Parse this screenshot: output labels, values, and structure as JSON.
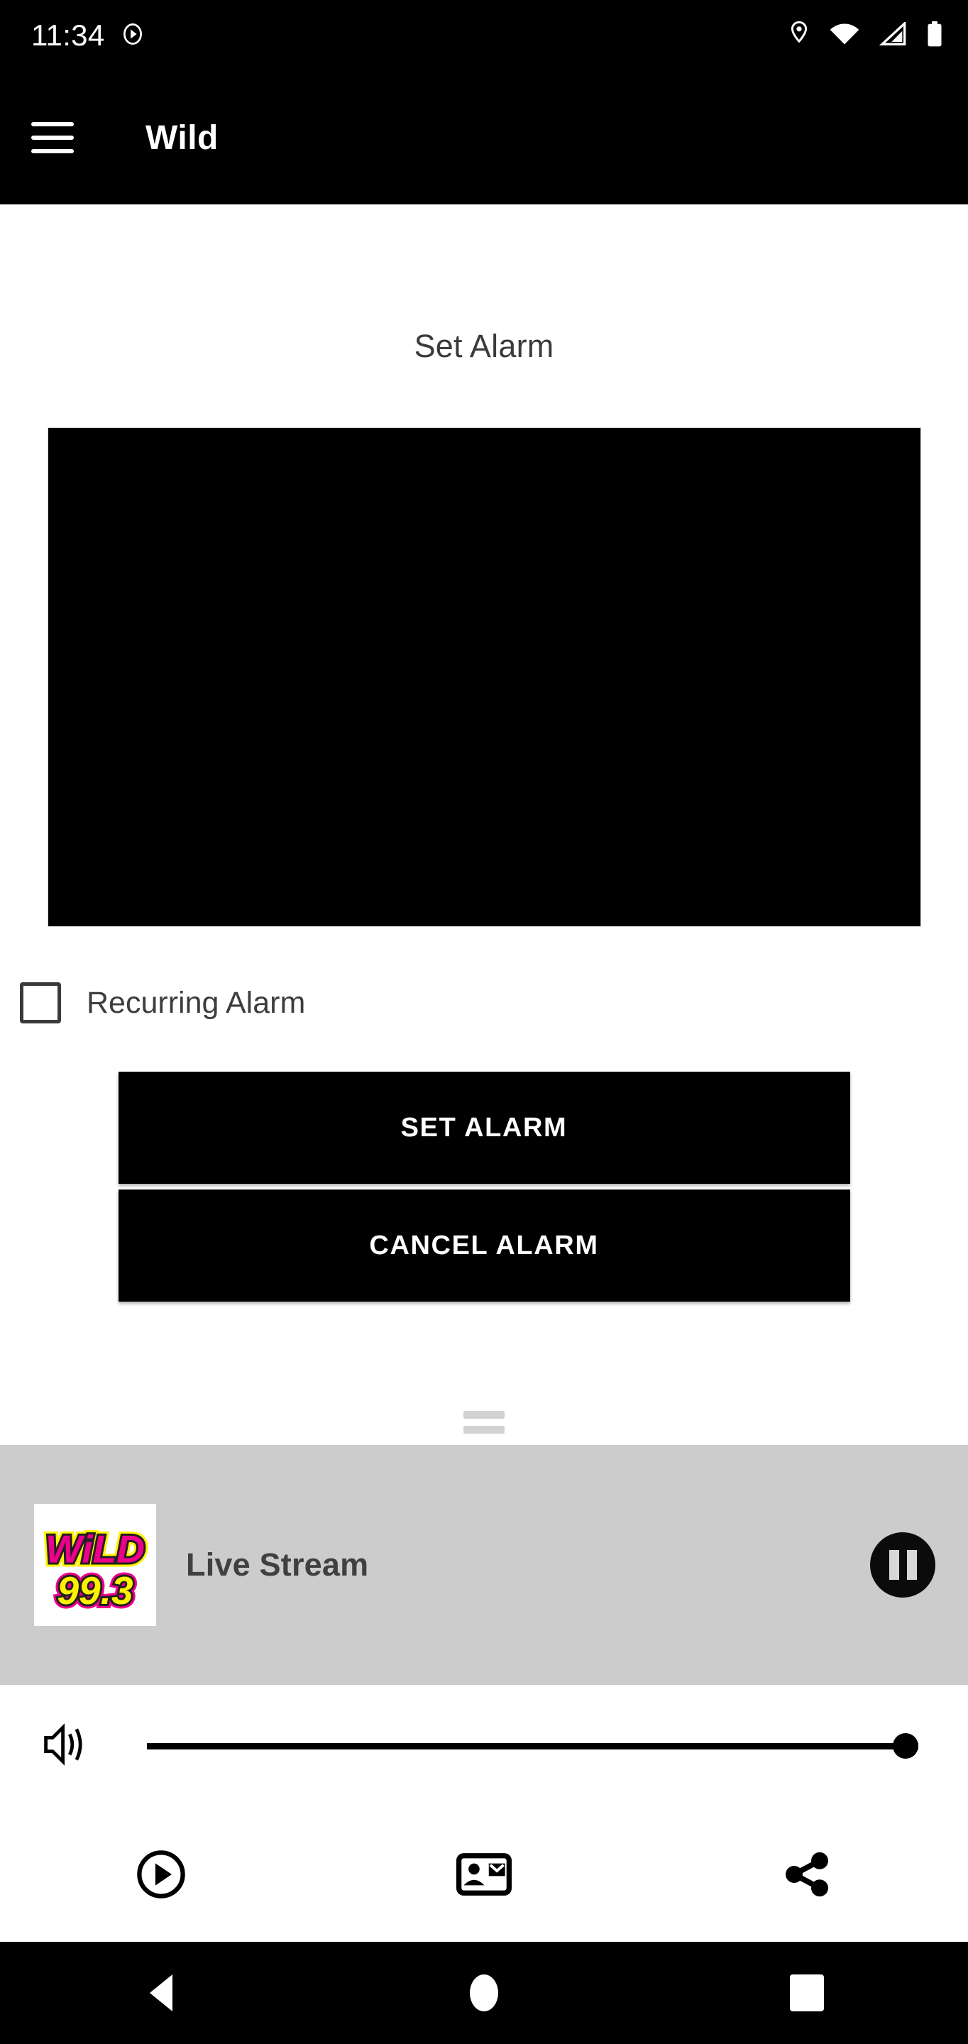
{
  "status_bar": {
    "time": "11:34",
    "left_icons": [
      "play-circle-icon"
    ],
    "right_icons": [
      "location-pin-icon",
      "wifi-icon",
      "cellular-signal-icon",
      "battery-icon"
    ]
  },
  "app_bar": {
    "menu_icon": "hamburger-menu-icon",
    "title": "Wild"
  },
  "main": {
    "section_title": "Set Alarm",
    "time_picker": {
      "label": "time-picker",
      "background": "#000000"
    },
    "recurring": {
      "label": "Recurring Alarm",
      "checked": false
    },
    "buttons": [
      {
        "label": "SET ALARM",
        "name": "set-alarm-button"
      },
      {
        "label": "CANCEL ALARM",
        "name": "cancel-alarm-button"
      }
    ]
  },
  "player": {
    "station_logo": {
      "name": "wild-99-3-logo",
      "line1": "WiLD",
      "line2": "99.3",
      "pink": "#EC008C",
      "yellow": "#FFF200",
      "outline": "#231F20",
      "background": "#FFFFFF"
    },
    "track_title": "Live Stream",
    "transport_button": {
      "state": "pause",
      "icon": "pause-icon"
    },
    "background": "#CCCCCC",
    "drag_handle": "drag-handle"
  },
  "volume": {
    "icon": "volume-up-icon",
    "value": 100,
    "min": 0,
    "max": 100
  },
  "actions": [
    {
      "name": "play-circle-icon",
      "label": "play"
    },
    {
      "name": "contact-card-icon",
      "label": "contact"
    },
    {
      "name": "share-icon",
      "label": "share"
    }
  ],
  "nav_bar": {
    "back": "back-triangle-icon",
    "home": "home-circle-icon",
    "recents": "recents-square-icon"
  }
}
